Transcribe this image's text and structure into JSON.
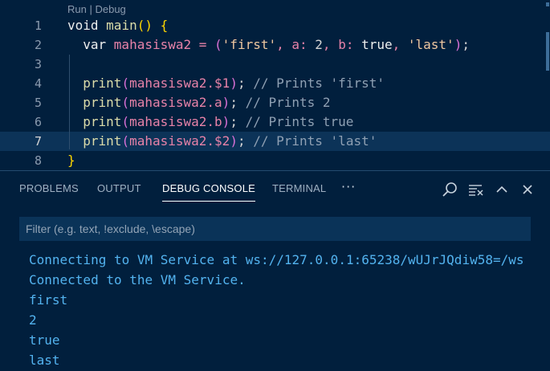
{
  "editor": {
    "codelens": {
      "run": "Run",
      "separator": " | ",
      "debug": "Debug"
    },
    "line_numbers": [
      "1",
      "2",
      "3",
      "4",
      "5",
      "6",
      "7",
      "8"
    ],
    "lines": [
      {
        "kw": "void ",
        "fn": "main",
        "b1": "()",
        "rest": " ",
        "b1b": "{"
      },
      {
        "indent": "  ",
        "kw": "var ",
        "var": "mahasiswa2",
        "eq": " = ",
        "b2": "(",
        "s1": "'first'",
        "p1": ", a: ",
        "n1": "2",
        "p2": ", b: ",
        "t": "true",
        "p3": ", ",
        "s2": "'last'",
        "b2b": ")",
        "end": ";"
      },
      {},
      {
        "indent": "  ",
        "fn": "print",
        "b2": "(",
        "var": "mahasiswa2.$1",
        "b2b": ")",
        "end": "; ",
        "comment": "// Prints 'first'"
      },
      {
        "indent": "  ",
        "fn": "print",
        "b2": "(",
        "var": "mahasiswa2.a",
        "b2b": ")",
        "end": "; ",
        "comment": "// Prints 2"
      },
      {
        "indent": "  ",
        "fn": "print",
        "b2": "(",
        "var": "mahasiswa2.b",
        "b2b": ")",
        "end": "; ",
        "comment": "// Prints true"
      },
      {
        "indent": "  ",
        "fn": "print",
        "b2": "(",
        "var": "mahasiswa2.$2",
        "b2b": ")",
        "end": "; ",
        "comment": "// Prints 'last'"
      },
      {
        "b1b": "}"
      }
    ]
  },
  "panel": {
    "tabs": [
      {
        "label": "PROBLEMS"
      },
      {
        "label": "OUTPUT"
      },
      {
        "label": "DEBUG CONSOLE"
      },
      {
        "label": "TERMINAL"
      }
    ],
    "more_label": "···",
    "filter_placeholder": "Filter (e.g. text, !exclude, \\escape)",
    "output": [
      "Connecting to VM Service at ws://127.0.0.1:65238/wUJrJQdiw58=/ws",
      "Connected to the VM Service.",
      "first",
      "2",
      "true",
      "last"
    ]
  },
  "icons": [
    "search-icon",
    "clear-console-icon",
    "chevron-up-icon",
    "close-icon"
  ]
}
